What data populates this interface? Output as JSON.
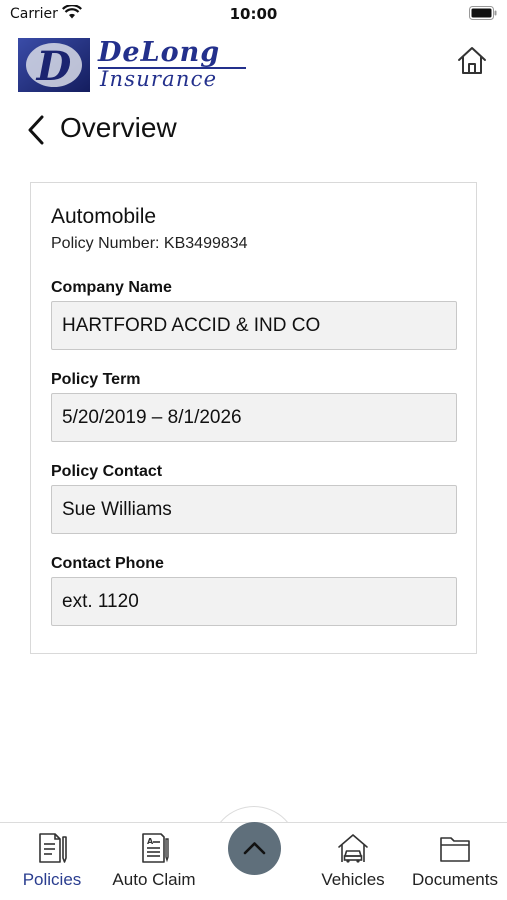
{
  "status_bar": {
    "carrier": "Carrier",
    "time": "10:00"
  },
  "header": {
    "logo_brand": "DeLong",
    "logo_sub": "Insurance",
    "logo_mark_letter": "D"
  },
  "nav": {
    "title": "Overview"
  },
  "policy": {
    "type": "Automobile",
    "number_text": "Policy Number: KB3499834",
    "fields": [
      {
        "label": "Company Name",
        "value": "HARTFORD ACCID & IND CO"
      },
      {
        "label": "Policy Term",
        "value": "5/20/2019 – 8/1/2026"
      },
      {
        "label": "Policy Contact",
        "value": "Sue Williams"
      },
      {
        "label": "Contact Phone",
        "value": "ext. 1120"
      }
    ]
  },
  "tabs": [
    {
      "label": "Policies",
      "icon": "document-pen-icon",
      "active": true
    },
    {
      "label": "Auto Claim",
      "icon": "claim-form-icon",
      "active": false
    },
    {
      "label": "Vehicles",
      "icon": "car-garage-icon",
      "active": false
    },
    {
      "label": "Documents",
      "icon": "folder-icon",
      "active": false
    }
  ],
  "colors": {
    "brand": "#23308c",
    "active_tab": "#2a3d8f",
    "center_button": "#5f6f7b",
    "field_background": "#f2f2f2"
  }
}
